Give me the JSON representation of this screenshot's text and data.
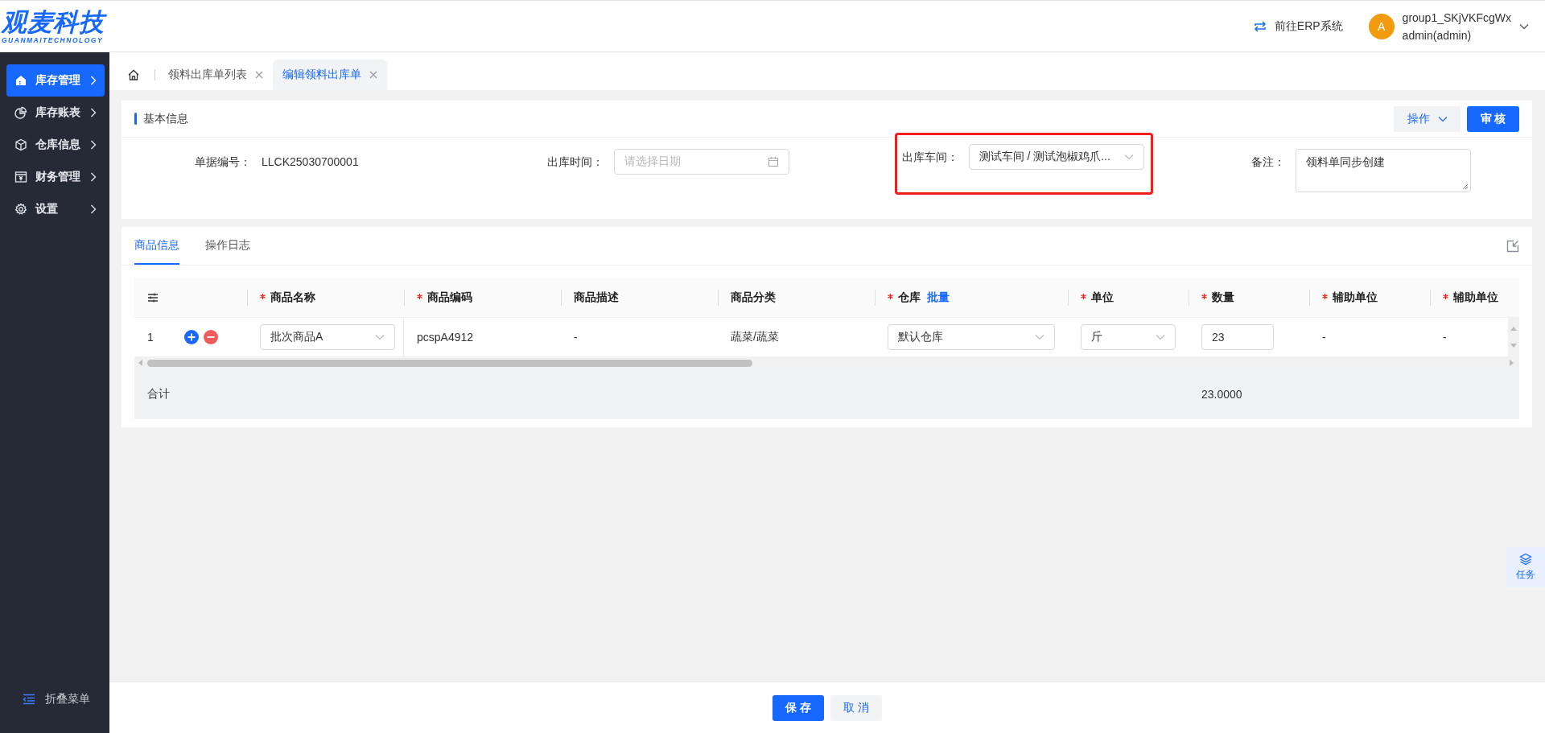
{
  "header": {
    "logo": {
      "name": "观麦科技",
      "tagline": "GUANMAITECHNOLOGY"
    },
    "erp_link": "前往ERP系统",
    "user": {
      "avatar": "A",
      "group": "group1_SKjVKFcgWx",
      "account": "admin(admin)"
    }
  },
  "sidebar": {
    "items": [
      {
        "label": "库存管理",
        "selected": true
      },
      {
        "label": "库存账表",
        "selected": false
      },
      {
        "label": "仓库信息",
        "selected": false
      },
      {
        "label": "财务管理",
        "selected": false
      },
      {
        "label": "设置",
        "selected": false
      }
    ],
    "collapse": "折叠菜单"
  },
  "page_tabs": [
    {
      "label": "领料出库单列表",
      "selected": false
    },
    {
      "label": "编辑领料出库单",
      "selected": true
    }
  ],
  "basic_info": {
    "title": "基本信息",
    "actions": [
      {
        "kind": "dropdown",
        "label": "操作"
      },
      {
        "kind": "primary",
        "label": "审 核"
      }
    ],
    "fields": [
      {
        "kind": "text",
        "label": "单据编号：",
        "value": "LLCK25030700001"
      },
      {
        "kind": "date",
        "label": "出库时间：",
        "placeholder": "请选择日期"
      },
      {
        "kind": "select",
        "label": "出库车间：",
        "value": "测试车间 / 测试泡椒鸡爪...",
        "highlighted": true
      },
      {
        "kind": "textarea",
        "label": "备注：",
        "value": "领料单同步创建"
      }
    ]
  },
  "goods": {
    "tabs": [
      {
        "label": "商品信息",
        "selected": true
      },
      {
        "label": "操作日志",
        "selected": false
      }
    ],
    "table": {
      "columns": [
        {
          "label": "商品名称",
          "required": true
        },
        {
          "label": "商品编码",
          "required": true
        },
        {
          "label": "商品描述",
          "required": false
        },
        {
          "label": "商品分类",
          "required": false
        },
        {
          "label": "仓库",
          "required": true,
          "link": "批量"
        },
        {
          "label": "单位",
          "required": true
        },
        {
          "label": "数量",
          "required": true,
          "total": "23.0000"
        },
        {
          "label": "辅助单位",
          "required": true
        },
        {
          "label": "辅助单位",
          "required": true
        }
      ],
      "rows": [
        {
          "index": "1",
          "cells": [
            {
              "kind": "select",
              "value": "批次商品A"
            },
            {
              "kind": "text",
              "value": "pcspA4912"
            },
            {
              "kind": "text",
              "value": "-"
            },
            {
              "kind": "text",
              "value": "蔬菜/蔬菜"
            },
            {
              "kind": "select",
              "value": "默认仓库"
            },
            {
              "kind": "select",
              "value": "斤"
            },
            {
              "kind": "input",
              "value": "23"
            },
            {
              "kind": "text",
              "value": "-"
            },
            {
              "kind": "text",
              "value": "-"
            }
          ]
        }
      ],
      "summary_label": "合计"
    }
  },
  "float_button": "任务",
  "footer": {
    "buttons": [
      {
        "kind": "primary",
        "label": "保 存"
      },
      {
        "kind": "default",
        "label": "取 消"
      }
    ]
  }
}
